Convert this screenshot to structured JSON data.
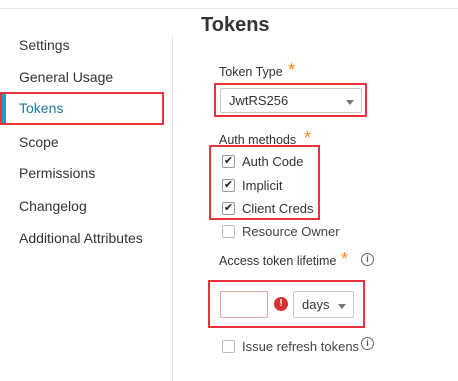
{
  "page_title": "Tokens",
  "sidebar": {
    "items": [
      {
        "label": "Settings"
      },
      {
        "label": "General Usage"
      },
      {
        "label": "Tokens",
        "active": true
      },
      {
        "label": "Scope"
      },
      {
        "label": "Permissions"
      },
      {
        "label": "Changelog"
      },
      {
        "label": "Additional Attributes"
      }
    ]
  },
  "form": {
    "token_type": {
      "label": "Token Type",
      "required_mark": "*",
      "value": "JwtRS256"
    },
    "auth_methods": {
      "label": "Auth methods",
      "required_mark": "*",
      "options": [
        {
          "label": "Auth Code",
          "checked": true,
          "check_glyph": "✔"
        },
        {
          "label": "Implicit",
          "checked": true,
          "check_glyph": "✔"
        },
        {
          "label": "Client Creds",
          "checked": true,
          "check_glyph": "✔"
        },
        {
          "label": "Resource Owner",
          "checked": false,
          "check_glyph": ""
        }
      ]
    },
    "access_token_lifetime": {
      "label": "Access token lifetime",
      "required_mark": "*",
      "info_glyph": "i",
      "value": "",
      "error_glyph": "!",
      "unit": "days"
    },
    "issue_refresh_tokens": {
      "label": "Issue refresh tokens",
      "checked": false,
      "info_glyph": "i"
    }
  },
  "colors": {
    "highlight_red": "#e8333d",
    "active_accent": "#1aa0c8",
    "required_orange": "#f5891f",
    "error_red": "#d9302f"
  }
}
